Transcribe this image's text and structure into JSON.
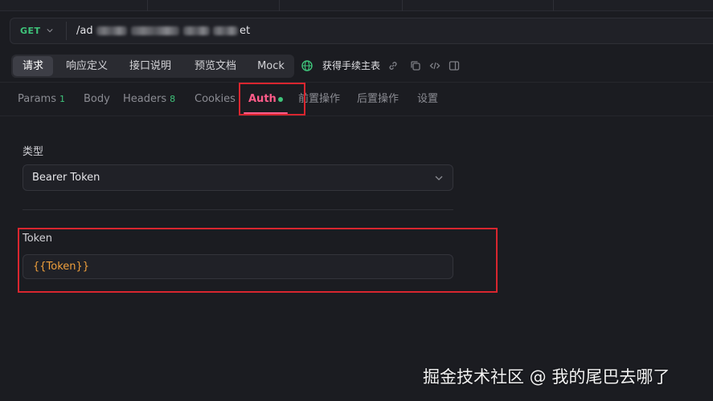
{
  "request": {
    "method": "GET",
    "url_prefix": "/ad",
    "url_suffix": "et"
  },
  "segments": [
    {
      "label": "请求",
      "active": true
    },
    {
      "label": "响应定义",
      "active": false
    },
    {
      "label": "接口说明",
      "active": false
    },
    {
      "label": "预览文档",
      "active": false
    },
    {
      "label": "Mock",
      "active": false
    }
  ],
  "environment": {
    "label": "获得手续主表"
  },
  "tabs": [
    {
      "label": "Params",
      "badge": "1"
    },
    {
      "label": "Body",
      "badge": ""
    },
    {
      "label": "Headers",
      "badge": "8"
    },
    {
      "label": "Cookies",
      "badge": ""
    },
    {
      "label": "Auth",
      "badge": "",
      "active": true
    },
    {
      "label": "前置操作",
      "badge": ""
    },
    {
      "label": "后置操作",
      "badge": ""
    },
    {
      "label": "设置",
      "badge": ""
    }
  ],
  "auth": {
    "type_label": "类型",
    "type_value": "Bearer Token",
    "token_label": "Token",
    "token_value": "{{Token}}"
  },
  "watermark": "掘金技术社区 @ 我的尾巴去哪了",
  "colors": {
    "accent_pink": "#ff5c8a",
    "method_green": "#3ec47a",
    "token_orange": "#f0a03c",
    "highlight_red": "#d9262f"
  }
}
